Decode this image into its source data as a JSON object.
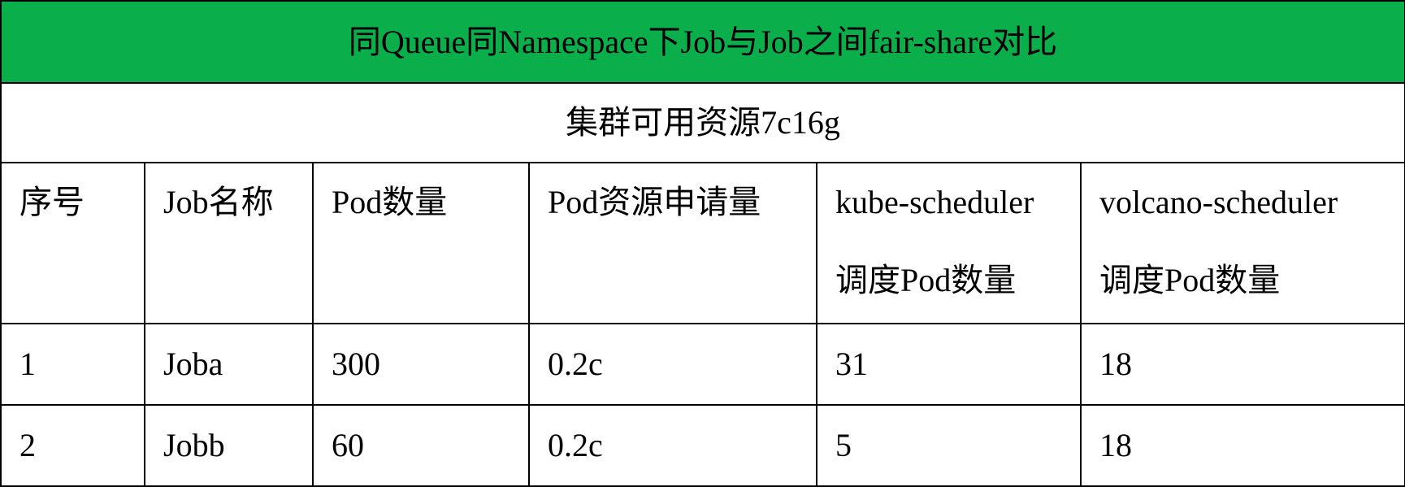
{
  "chart_data": {
    "type": "table",
    "title": "同Queue同Namespace下Job与Job之间fair-share对比",
    "subtitle": "集群可用资源7c16g",
    "header_color": "#0aaf4b",
    "columns": [
      [
        "序号"
      ],
      [
        "Job名称"
      ],
      [
        "Pod数量"
      ],
      [
        "Pod资源申请量"
      ],
      [
        "kube-scheduler",
        "调度Pod数量"
      ],
      [
        "volcano-scheduler",
        "调度Pod数量"
      ]
    ],
    "rows": [
      [
        "1",
        "Joba",
        "300",
        "0.2c",
        "31",
        "18"
      ],
      [
        "2",
        "Jobb",
        "60",
        "0.2c",
        "5",
        "18"
      ]
    ]
  }
}
